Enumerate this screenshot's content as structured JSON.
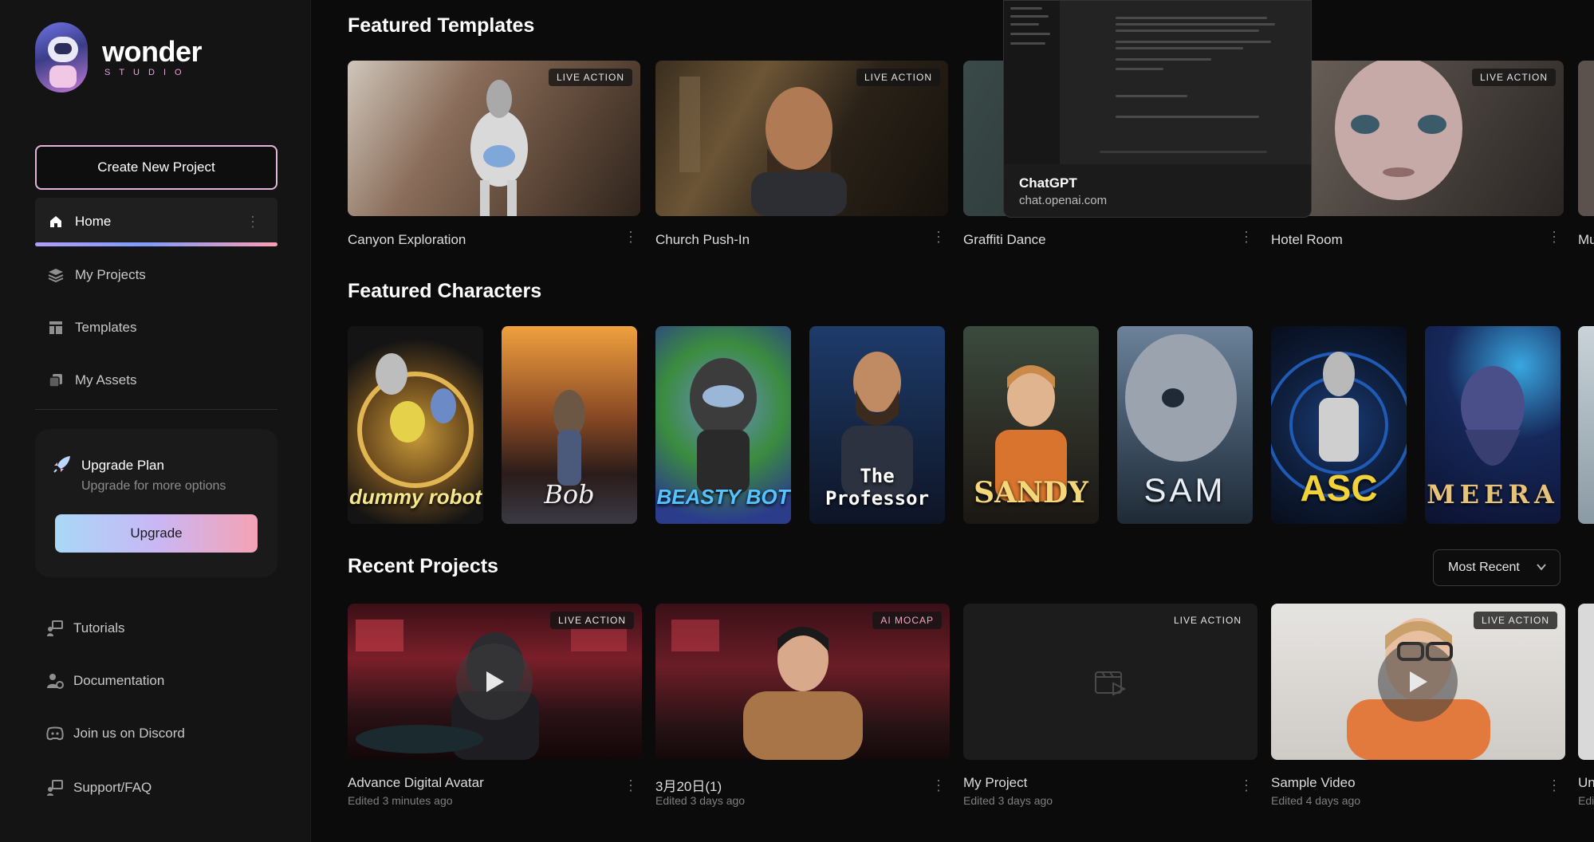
{
  "brand": {
    "name": "wonder",
    "sub": "STUDIO"
  },
  "sidebar": {
    "create_label": "Create New Project",
    "nav": [
      {
        "label": "Home",
        "icon": "home-icon"
      },
      {
        "label": "My Projects",
        "icon": "layers-icon"
      },
      {
        "label": "Templates",
        "icon": "templates-icon"
      },
      {
        "label": "My Assets",
        "icon": "assets-icon"
      }
    ],
    "upgrade": {
      "title": "Upgrade Plan",
      "subtitle": "Upgrade for more options",
      "button": "Upgrade"
    },
    "links": [
      {
        "label": "Tutorials",
        "icon": "tutorials-icon"
      },
      {
        "label": "Documentation",
        "icon": "documentation-icon"
      },
      {
        "label": "Join us on Discord",
        "icon": "discord-icon"
      },
      {
        "label": "Support/FAQ",
        "icon": "support-icon"
      }
    ]
  },
  "templates": {
    "title": "Featured Templates",
    "items": [
      {
        "label": "Canyon Exploration",
        "badge": "LIVE ACTION"
      },
      {
        "label": "Church Push-In",
        "badge": "LIVE ACTION"
      },
      {
        "label": "Graffiti Dance",
        "badge": ""
      },
      {
        "label": "Hotel Room",
        "badge": "LIVE ACTION"
      },
      {
        "label": "Mu",
        "badge": ""
      }
    ]
  },
  "characters": {
    "title": "Featured Characters",
    "items": [
      "dummy robot",
      "Bob",
      "BEASTY BOT",
      "The Professor",
      "SANDY",
      "SAM",
      "ASC",
      "MEERA"
    ]
  },
  "recent": {
    "title": "Recent Projects",
    "sort_label": "Most Recent",
    "items": [
      {
        "label": "Advance Digital Avatar",
        "sub": "Edited 3 minutes ago",
        "badge": "LIVE ACTION"
      },
      {
        "label": "3月20日(1)",
        "sub": "Edited 3 days ago",
        "badge": "AI MOCAP"
      },
      {
        "label": "My Project",
        "sub": "Edited 3 days ago",
        "badge": "LIVE ACTION"
      },
      {
        "label": "Sample Video",
        "sub": "Edited 4 days ago",
        "badge": "LIVE ACTION"
      },
      {
        "label": "Un",
        "sub": "Edi",
        "badge": ""
      }
    ]
  },
  "popup": {
    "title": "ChatGPT",
    "url": "chat.openai.com"
  },
  "colors": {
    "accent_pink": "#e2b6d8",
    "upgrade_gradient_start": "#a9d8f6",
    "upgrade_gradient_end": "#f5a2b4"
  }
}
